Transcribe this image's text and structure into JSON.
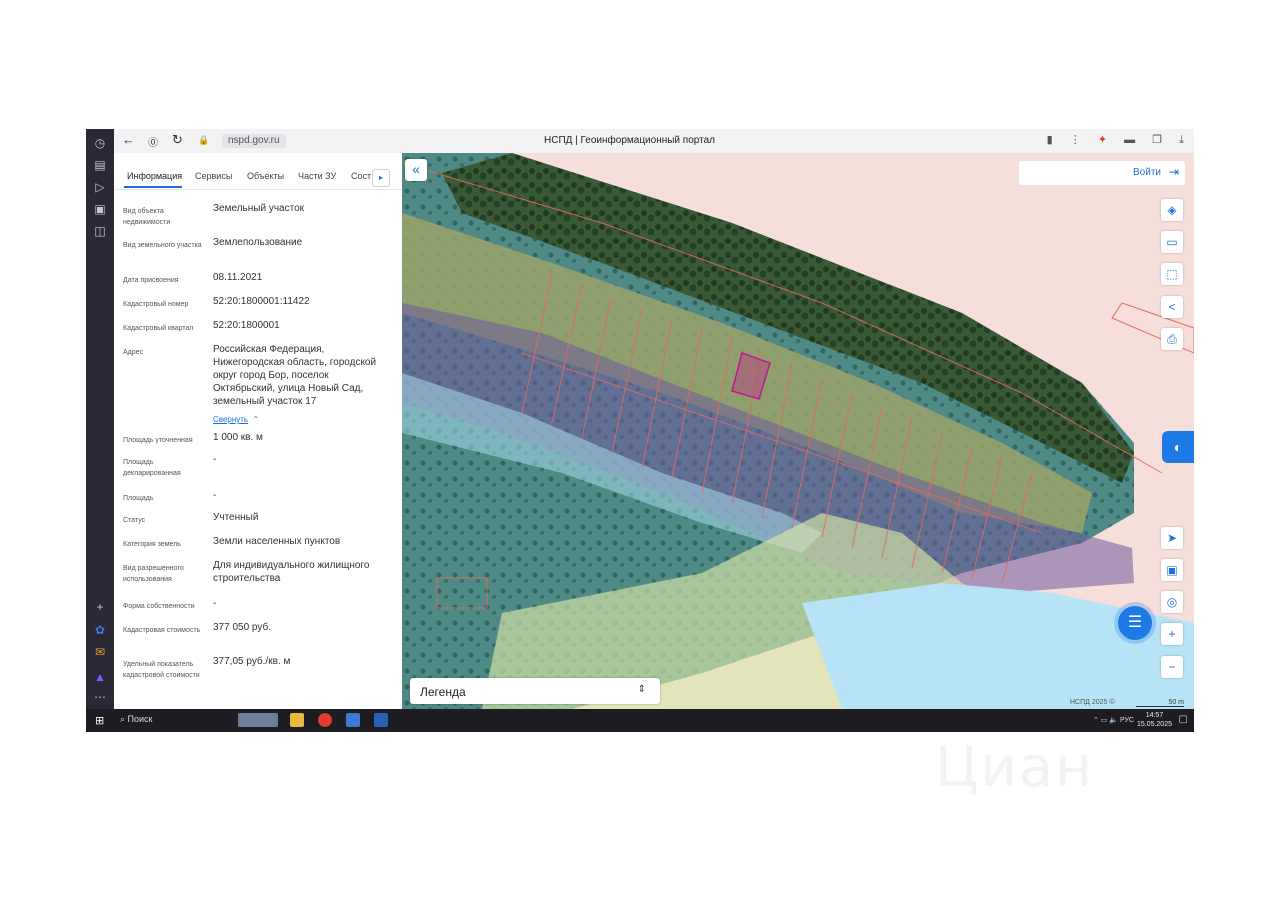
{
  "browser": {
    "url": "nspd.gov.ru",
    "window_title": "НСПД | Геоинформационный портал"
  },
  "panel": {
    "tabs": [
      "Информация",
      "Сервисы",
      "Объекты",
      "Части ЗУ",
      "Сост"
    ],
    "fields": [
      {
        "label": "Вид объекта недвижимости",
        "value": "Земельный участок"
      },
      {
        "label": "Вид земельного участка",
        "value": "Землепользование"
      },
      {
        "label": "Дата присвоения",
        "value": "08.11.2021"
      },
      {
        "label": "Кадастровый номер",
        "value": "52:20:1800001:11422"
      },
      {
        "label": "Кадастровый квартал",
        "value": "52:20:1800001"
      },
      {
        "label": "Адрес",
        "value": "Российская Федерация, Нижегородская область, городской округ город Бор, поселок Октябрьский, улица Новый Сад, земельный участок 17"
      },
      {
        "label": "Площадь уточненная",
        "value": "1 000 кв. м"
      },
      {
        "label": "Площадь декларированная",
        "value": "-"
      },
      {
        "label": "Площадь",
        "value": "-"
      },
      {
        "label": "Статус",
        "value": "Учтенный"
      },
      {
        "label": "Категория земель",
        "value": "Земли населенных пунктов"
      },
      {
        "label": "Вид разрешенного использования",
        "value": "Для индивидуального жилищного строительства"
      },
      {
        "label": "Форма собственности",
        "value": "-"
      },
      {
        "label": "Кадастровая стоимость",
        "value": "377 050 руб."
      },
      {
        "label": "Удельный показатель кадастровой стоимости",
        "value": "377,05 руб./кв. м"
      }
    ],
    "collapse_link": "Свернуть"
  },
  "map": {
    "login_label": "Войти",
    "legend_label": "Легенда",
    "attribution": "НСПД 2025 ©",
    "scale_label": "50 m"
  },
  "taskbar": {
    "search_label": "Поиск",
    "lang": "РУС",
    "time": "14:57",
    "date": "15.05.2025"
  },
  "watermark": "Циан",
  "colors": {
    "accent": "#1e6fd9",
    "parcel_pink": "#f6dedb",
    "parcel_border": "#e06b5e",
    "selected_parcel": "#c2188f"
  }
}
